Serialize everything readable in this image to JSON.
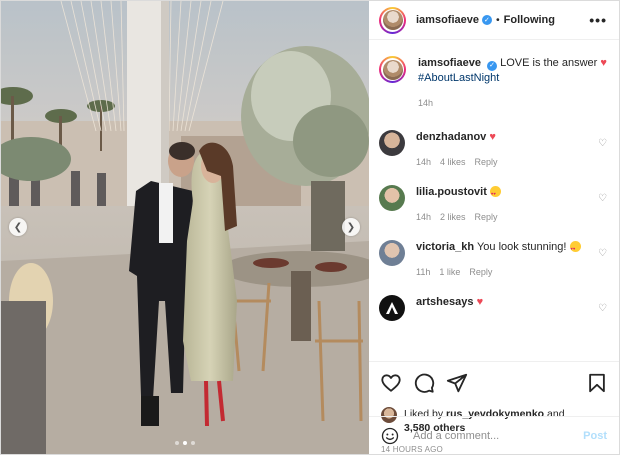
{
  "post": {
    "author": "iamsofiaeve",
    "follow_status": "Following",
    "separator": "•",
    "more_label": "•••",
    "caption_text": "LOVE is the answer",
    "caption_hashtag": "#AboutLastNight",
    "caption_age": "14h"
  },
  "comments": [
    {
      "user": "denzhadanov",
      "text": "",
      "emoji": "heart",
      "age": "14h",
      "likes": "4 likes",
      "reply": "Reply"
    },
    {
      "user": "lilia.poustovit",
      "text": "",
      "emoji": "heart-eyes",
      "age": "14h",
      "likes": "2 likes",
      "reply": "Reply"
    },
    {
      "user": "victoria_kh",
      "text": "You look stunning!",
      "emoji": "heart-eyes",
      "age": "11h",
      "likes": "1 like",
      "reply": "Reply"
    },
    {
      "user": "artshesays",
      "text": "",
      "emoji": "heart"
    }
  ],
  "likes": {
    "prefix": "Liked by",
    "user": "rus_yevdokymenko",
    "joiner": "and",
    "others": "3,580 others"
  },
  "timestamp": "14 HOURS AGO",
  "add_comment": {
    "placeholder": "Add a comment...",
    "post_label": "Post"
  },
  "carousel": {
    "slides": 3,
    "active_slide": 2
  },
  "icons": {
    "heart": "heart-icon",
    "comment": "comment-icon",
    "share": "share-icon",
    "save": "bookmark-icon",
    "emoji": "smiley-icon",
    "verified": "verified-badge-icon"
  },
  "colors": {
    "link_blue": "#00376b",
    "verified_blue": "#3897f0",
    "heart_red": "#ed4956",
    "muted_text": "#8e8e8e",
    "post_button_disabled": "#b2dffc"
  }
}
